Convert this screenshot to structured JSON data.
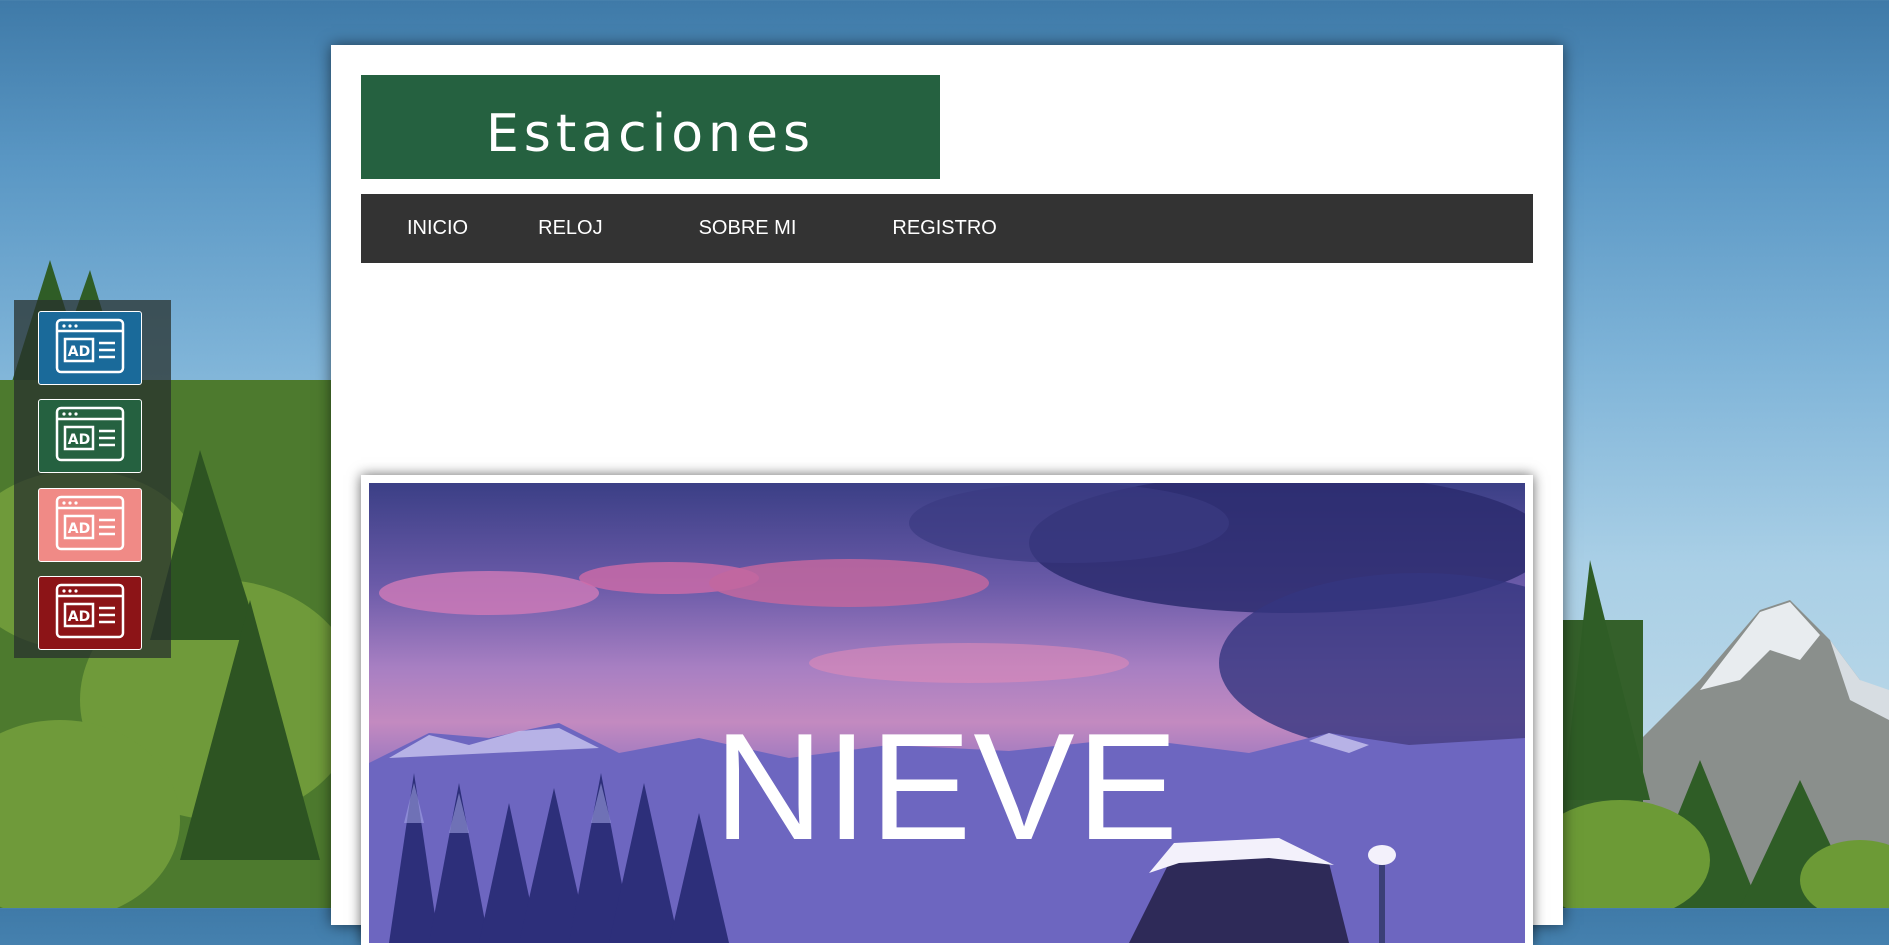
{
  "site": {
    "logo_text": "Estaciones"
  },
  "nav": {
    "items": [
      {
        "label": "INICIO"
      },
      {
        "label": "RELOJ"
      },
      {
        "label": "SOBRE MI"
      },
      {
        "label": "REGISTRO"
      }
    ]
  },
  "hero": {
    "title": "NIEVE"
  },
  "ads": {
    "icon": "ad-window-icon",
    "items": [
      {
        "color": "#1a6a9a"
      },
      {
        "color": "#256140"
      },
      {
        "color": "#f08a86"
      },
      {
        "color": "#8c1417"
      }
    ]
  }
}
